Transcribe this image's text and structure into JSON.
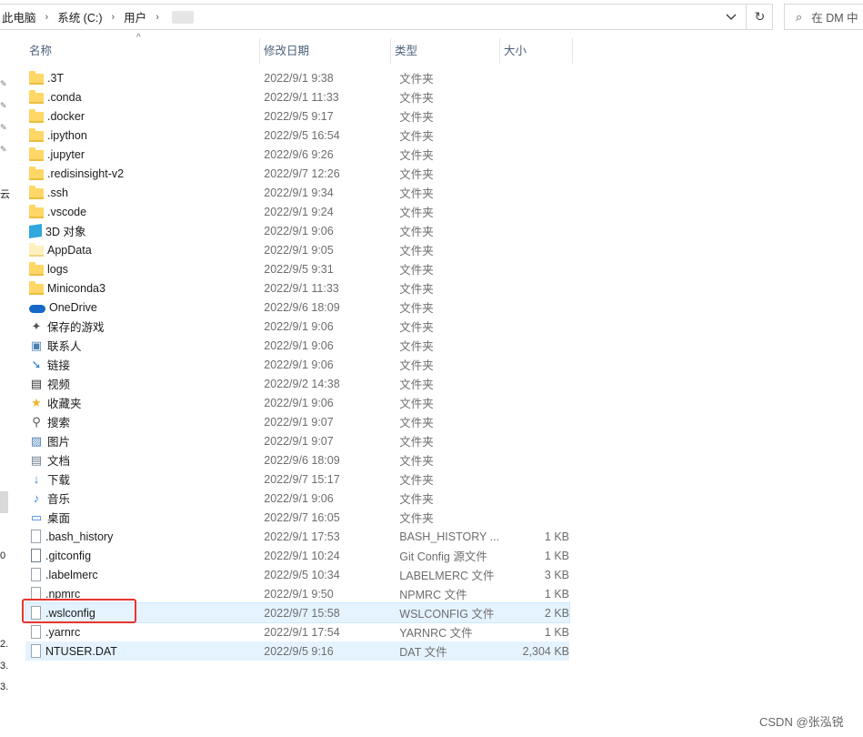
{
  "address_bar": {
    "crumbs": [
      "此电脑",
      "系统 (C:)",
      "用户"
    ],
    "separator": "›"
  },
  "search": {
    "text": "在 DM 中"
  },
  "columns": {
    "name": "名称",
    "date": "修改日期",
    "type": "类型",
    "size": "大小"
  },
  "left_fragments": [
    "云",
    "0",
    "2.",
    "3.",
    "3."
  ],
  "rows": [
    {
      "name": ".3T",
      "date": "2022/9/1 9:38",
      "type": "文件夹",
      "size": "",
      "icon": "folder"
    },
    {
      "name": ".conda",
      "date": "2022/9/1 11:33",
      "type": "文件夹",
      "size": "",
      "icon": "folder"
    },
    {
      "name": ".docker",
      "date": "2022/9/5 9:17",
      "type": "文件夹",
      "size": "",
      "icon": "folder"
    },
    {
      "name": ".ipython",
      "date": "2022/9/5 16:54",
      "type": "文件夹",
      "size": "",
      "icon": "folder"
    },
    {
      "name": ".jupyter",
      "date": "2022/9/6 9:26",
      "type": "文件夹",
      "size": "",
      "icon": "folder"
    },
    {
      "name": ".redisinsight-v2",
      "date": "2022/9/7 12:26",
      "type": "文件夹",
      "size": "",
      "icon": "folder"
    },
    {
      "name": ".ssh",
      "date": "2022/9/1 9:34",
      "type": "文件夹",
      "size": "",
      "icon": "folder"
    },
    {
      "name": ".vscode",
      "date": "2022/9/1 9:24",
      "type": "文件夹",
      "size": "",
      "icon": "folder"
    },
    {
      "name": "3D 对象",
      "date": "2022/9/1 9:06",
      "type": "文件夹",
      "size": "",
      "icon": "cube-3d"
    },
    {
      "name": "AppData",
      "date": "2022/9/1 9:05",
      "type": "文件夹",
      "size": "",
      "icon": "folder-hidden"
    },
    {
      "name": "logs",
      "date": "2022/9/5 9:31",
      "type": "文件夹",
      "size": "",
      "icon": "folder"
    },
    {
      "name": "Miniconda3",
      "date": "2022/9/1 11:33",
      "type": "文件夹",
      "size": "",
      "icon": "folder"
    },
    {
      "name": "OneDrive",
      "date": "2022/9/6 18:09",
      "type": "文件夹",
      "size": "",
      "icon": "onedrive-cloud"
    },
    {
      "name": "保存的游戏",
      "date": "2022/9/1 9:06",
      "type": "文件夹",
      "size": "",
      "icon": "saved-games"
    },
    {
      "name": "联系人",
      "date": "2022/9/1 9:06",
      "type": "文件夹",
      "size": "",
      "icon": "contacts"
    },
    {
      "name": "链接",
      "date": "2022/9/1 9:06",
      "type": "文件夹",
      "size": "",
      "icon": "links-arrow"
    },
    {
      "name": "视频",
      "date": "2022/9/2 14:38",
      "type": "文件夹",
      "size": "",
      "icon": "videos-film"
    },
    {
      "name": "收藏夹",
      "date": "2022/9/1 9:06",
      "type": "文件夹",
      "size": "",
      "icon": "favorites-star"
    },
    {
      "name": "搜索",
      "date": "2022/9/1 9:07",
      "type": "文件夹",
      "size": "",
      "icon": "search-magnifier"
    },
    {
      "name": "图片",
      "date": "2022/9/1 9:07",
      "type": "文件夹",
      "size": "",
      "icon": "pictures"
    },
    {
      "name": "文档",
      "date": "2022/9/6 18:09",
      "type": "文件夹",
      "size": "",
      "icon": "documents"
    },
    {
      "name": "下载",
      "date": "2022/9/7 15:17",
      "type": "文件夹",
      "size": "",
      "icon": "download-arrow"
    },
    {
      "name": "音乐",
      "date": "2022/9/1 9:06",
      "type": "文件夹",
      "size": "",
      "icon": "music-note"
    },
    {
      "name": "桌面",
      "date": "2022/9/7 16:05",
      "type": "文件夹",
      "size": "",
      "icon": "desktop"
    },
    {
      "name": ".bash_history",
      "date": "2022/9/1 17:53",
      "type": "BASH_HISTORY ...",
      "size": "1 KB",
      "icon": "file"
    },
    {
      "name": ".gitconfig",
      "date": "2022/9/1 10:24",
      "type": "Git Config 源文件",
      "size": "1 KB",
      "icon": "file-config"
    },
    {
      "name": ".labelmerc",
      "date": "2022/9/5 10:34",
      "type": "LABELMERC 文件",
      "size": "3 KB",
      "icon": "file"
    },
    {
      "name": ".npmrc",
      "date": "2022/9/1 9:50",
      "type": "NPMRC 文件",
      "size": "1 KB",
      "icon": "file"
    },
    {
      "name": ".wslconfig",
      "date": "2022/9/7 15:58",
      "type": "WSLCONFIG 文件",
      "size": "2 KB",
      "icon": "file",
      "hover": true
    },
    {
      "name": ".yarnrc",
      "date": "2022/9/1 17:54",
      "type": "YARNRC 文件",
      "size": "1 KB",
      "icon": "file"
    },
    {
      "name": "NTUSER.DAT",
      "date": "2022/9/5 9:16",
      "type": "DAT 文件",
      "size": "2,304 KB",
      "icon": "file",
      "selected": true
    }
  ],
  "watermark": "CSDN @张泓锐",
  "colors": {
    "folder": "#ffd767",
    "selection": "#e5f3ff",
    "highlight_box": "#e8342f",
    "header_text": "#4c607a"
  }
}
